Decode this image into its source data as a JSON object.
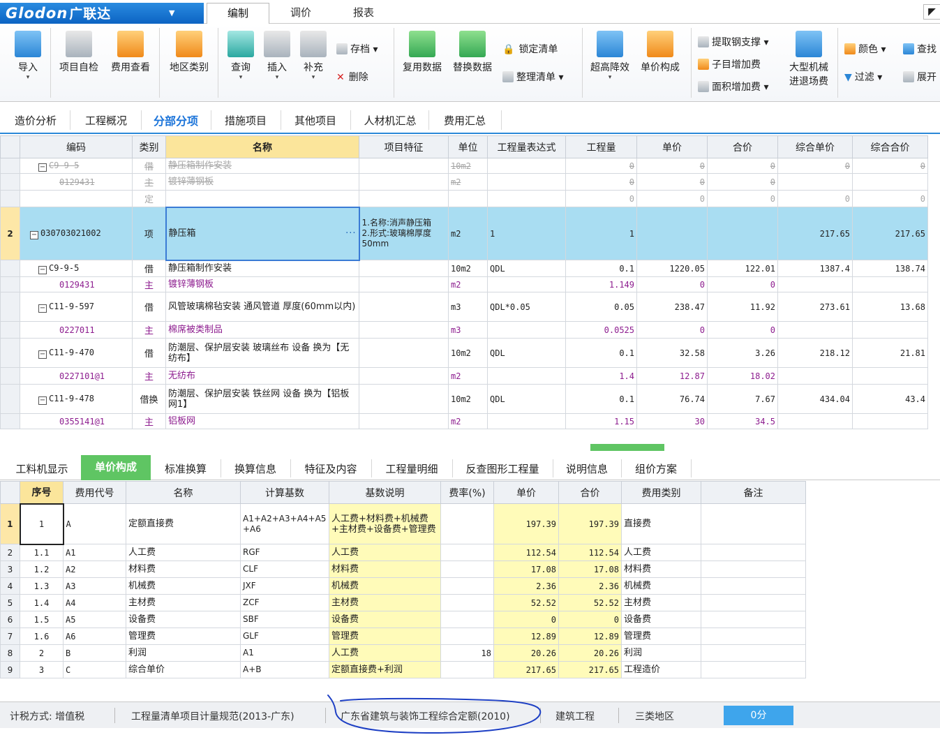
{
  "app": {
    "logo_text": "Glodon",
    "logo_cn": "广联达",
    "logo_arrow": "▼",
    "tabs": [
      {
        "label": "编制",
        "active": true
      },
      {
        "label": "调价",
        "active": false
      },
      {
        "label": "报表",
        "active": false
      }
    ],
    "corner": "◤"
  },
  "ribbon": {
    "import": "导入",
    "self_check": "项目自检",
    "fee_view": "费用查看",
    "region": "地区类别",
    "query": "查询",
    "insert": "插入",
    "supplement": "补充",
    "archive": "存档",
    "delete": "删除",
    "reuse": "复用数据",
    "replace": "替换数据",
    "lock_list": "锁定清单",
    "tidy_list": "整理清单",
    "over_height": "超高降效",
    "unit_price": "单价构成",
    "steel_support": "提取钢支撑",
    "sub_item_fee": "子目增加费",
    "area_fee": "面积增加费",
    "machine_in_out_1": "大型机械",
    "machine_in_out_2": "进退场费",
    "color": "颜色",
    "find": "查找",
    "filter": "过滤",
    "expand": "展开",
    "dropdown": "▾"
  },
  "subtabs": [
    "造价分析",
    "工程概况",
    "分部分项",
    "措施项目",
    "其他项目",
    "人材机汇总",
    "费用汇总"
  ],
  "main_grid": {
    "headers": [
      "编码",
      "类别",
      "名称",
      "项目特征",
      "单位",
      "工程量表达式",
      "工程量",
      "单价",
      "合价",
      "综合单价",
      "综合合价"
    ],
    "rows": [
      {
        "rn": "",
        "tree": "−",
        "code": "C9-9-5",
        "type": "借",
        "name": "静压箱制作安装",
        "feature": "",
        "unit": "10m2",
        "expr": "",
        "qty": "0",
        "price": "0",
        "total": "0",
        "cprice": "0",
        "ctotal": "0"
      },
      {
        "rn": "",
        "tree": "",
        "code": "0129431",
        "type": "主",
        "name": "镀锌薄钢板",
        "feature": "",
        "unit": "m2",
        "expr": "",
        "qty": "0",
        "price": "0",
        "total": "0",
        "cprice": "",
        "ctotal": ""
      },
      {
        "rn": "",
        "tree": "",
        "code": "",
        "type": "定",
        "name": "",
        "feature": "",
        "unit": "",
        "expr": "",
        "qty": "0",
        "price": "0",
        "total": "0",
        "cprice": "0",
        "ctotal": "0"
      },
      {
        "rn": "2",
        "tree": "−",
        "code": "030703021002",
        "type": "项",
        "name": "静压箱",
        "ellipsis": "···",
        "feature": "1.名称:消声静压箱\n2.形式:玻璃棉厚度50mm",
        "unit": "m2",
        "expr": "1",
        "qty": "1",
        "price": "",
        "total": "",
        "cprice": "217.65",
        "ctotal": "217.65"
      },
      {
        "rn": "",
        "tree": "−",
        "code": "C9-9-5",
        "type": "借",
        "name": "静压箱制作安装",
        "feature": "",
        "unit": "10m2",
        "expr": "QDL",
        "qty": "0.1",
        "price": "1220.05",
        "total": "122.01",
        "cprice": "1387.4",
        "ctotal": "138.74"
      },
      {
        "rn": "",
        "tree": "",
        "code": "0129431",
        "type": "主",
        "name": "镀锌薄钢板",
        "feature": "",
        "unit": "m2",
        "expr": "",
        "qty": "1.149",
        "price": "0",
        "total": "0",
        "cprice": "",
        "ctotal": ""
      },
      {
        "rn": "",
        "tree": "−",
        "code": "C11-9-597",
        "type": "借",
        "name": "风管玻璃棉毡安装 通风管道 厚度(60mm以内)",
        "feature": "",
        "unit": "m3",
        "expr": "QDL*0.05",
        "qty": "0.05",
        "price": "238.47",
        "total": "11.92",
        "cprice": "273.61",
        "ctotal": "13.68"
      },
      {
        "rn": "",
        "tree": "",
        "code": "0227011",
        "type": "主",
        "name": "棉席被类制品",
        "feature": "",
        "unit": "m3",
        "expr": "",
        "qty": "0.0525",
        "price": "0",
        "total": "0",
        "cprice": "",
        "ctotal": ""
      },
      {
        "rn": "",
        "tree": "−",
        "code": "C11-9-470",
        "type": "借",
        "name": "防潮层、保护层安装 玻璃丝布 设备  换为【无纺布】",
        "feature": "",
        "unit": "10m2",
        "expr": "QDL",
        "qty": "0.1",
        "price": "32.58",
        "total": "3.26",
        "cprice": "218.12",
        "ctotal": "21.81"
      },
      {
        "rn": "",
        "tree": "",
        "code": "0227101@1",
        "type": "主",
        "name": "无纺布",
        "feature": "",
        "unit": "m2",
        "expr": "",
        "qty": "1.4",
        "price": "12.87",
        "total": "18.02",
        "cprice": "",
        "ctotal": ""
      },
      {
        "rn": "",
        "tree": "−",
        "code": "C11-9-478",
        "type": "借换",
        "name": "防潮层、保护层安装 铁丝网 设备  换为【铝板网1】",
        "feature": "",
        "unit": "10m2",
        "expr": "QDL",
        "qty": "0.1",
        "price": "76.74",
        "total": "7.67",
        "cprice": "434.04",
        "ctotal": "43.4"
      },
      {
        "rn": "",
        "tree": "",
        "code": "0355141@1",
        "type": "主",
        "name": "铝板网",
        "feature": "",
        "unit": "m2",
        "expr": "",
        "qty": "1.15",
        "price": "30",
        "total": "34.5",
        "cprice": "",
        "ctotal": ""
      }
    ]
  },
  "bottom_tabs": [
    "工料机显示",
    "单价构成",
    "标准换算",
    "换算信息",
    "特征及内容",
    "工程量明细",
    "反查图形工程量",
    "说明信息",
    "组价方案"
  ],
  "bottom_grid": {
    "headers": [
      "序号",
      "费用代号",
      "名称",
      "计算基数",
      "基数说明",
      "费率(%)",
      "单价",
      "合价",
      "费用类别",
      "备注"
    ],
    "rows": [
      {
        "rn": "1",
        "seq": "1",
        "code": "A",
        "name": "定额直接费",
        "base": "A1+A2+A3+A4+A5+A6",
        "desc": "人工费+材料费+机械费+主材费+设备费+管理费",
        "rate": "",
        "price": "197.39",
        "total": "197.39",
        "category": "直接费",
        "note": ""
      },
      {
        "rn": "2",
        "seq": "1.1",
        "code": "A1",
        "name": "人工费",
        "base": "RGF",
        "desc": "人工费",
        "rate": "",
        "price": "112.54",
        "total": "112.54",
        "category": "人工费",
        "note": ""
      },
      {
        "rn": "3",
        "seq": "1.2",
        "code": "A2",
        "name": "材料费",
        "base": "CLF",
        "desc": "材料费",
        "rate": "",
        "price": "17.08",
        "total": "17.08",
        "category": "材料费",
        "note": ""
      },
      {
        "rn": "4",
        "seq": "1.3",
        "code": "A3",
        "name": "机械费",
        "base": "JXF",
        "desc": "机械费",
        "rate": "",
        "price": "2.36",
        "total": "2.36",
        "category": "机械费",
        "note": ""
      },
      {
        "rn": "5",
        "seq": "1.4",
        "code": "A4",
        "name": "主材费",
        "base": "ZCF",
        "desc": "主材费",
        "rate": "",
        "price": "52.52",
        "total": "52.52",
        "category": "主材费",
        "note": ""
      },
      {
        "rn": "6",
        "seq": "1.5",
        "code": "A5",
        "name": "设备费",
        "base": "SBF",
        "desc": "设备费",
        "rate": "",
        "price": "0",
        "total": "0",
        "category": "设备费",
        "note": ""
      },
      {
        "rn": "7",
        "seq": "1.6",
        "code": "A6",
        "name": "管理费",
        "base": "GLF",
        "desc": "管理费",
        "rate": "",
        "price": "12.89",
        "total": "12.89",
        "category": "管理费",
        "note": ""
      },
      {
        "rn": "8",
        "seq": "2",
        "code": "B",
        "name": "利润",
        "base": "A1",
        "desc": "人工费",
        "rate": "18",
        "price": "20.26",
        "total": "20.26",
        "category": "利润",
        "note": ""
      },
      {
        "rn": "9",
        "seq": "3",
        "code": "C",
        "name": "综合单价",
        "base": "A+B",
        "desc": "定额直接费+利润",
        "rate": "",
        "price": "217.65",
        "total": "217.65",
        "category": "工程造价",
        "note": ""
      }
    ]
  },
  "status": {
    "tax": "计税方式: 增值税",
    "spec": "工程量清单项目计量规范(2013-广东)",
    "quota": "广东省建筑与装饰工程综合定额(2010)",
    "type": "建筑工程",
    "region": "三类地区",
    "score": "0分"
  },
  "colors": {
    "accent": "#2b88d8",
    "selected_row": "#a9ddf2",
    "material_text": "#8d1d8f",
    "active_bottom_tab": "#5fc563",
    "annotation": "#1d3fc4"
  }
}
